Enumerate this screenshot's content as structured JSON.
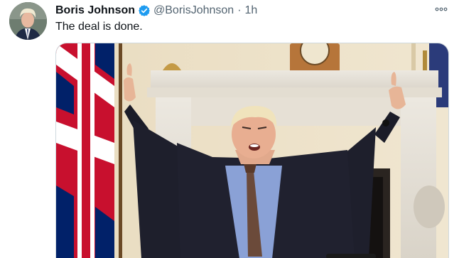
{
  "tweet": {
    "display_name": "Boris Johnson",
    "handle": "@BorisJohnson",
    "separator": "·",
    "time": "1h",
    "text": "The deal is done."
  },
  "icons": {
    "verified": "verified-badge-icon",
    "more": "more-options-icon"
  },
  "colors": {
    "verified_blue": "#1d9bf0",
    "name_text": "#0f1419",
    "secondary_text": "#536471"
  }
}
